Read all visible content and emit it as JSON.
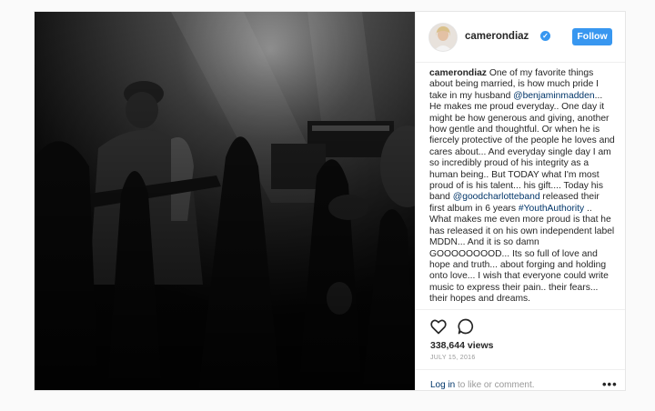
{
  "post": {
    "username": "camerondiaz",
    "follow_label": "Follow",
    "caption_parts": [
      {
        "type": "text",
        "text": " One of my favorite things about being married, is how much pride I take in my husband "
      },
      {
        "type": "link",
        "text": "@benjaminmadden"
      },
      {
        "type": "text",
        "text": "... He makes me proud everyday.. One day it might be how generous and giving, another how gentle and thoughtful. Or when he is fiercely protective of the people he loves and cares about... And everyday single day I am so incredibly proud of his integrity as a human being.. But TODAY what I'm most proud of is his talent... his gift.... Today his band "
      },
      {
        "type": "link",
        "text": "@goodcharlotteband"
      },
      {
        "type": "text",
        "text": " released their first album in 6 years "
      },
      {
        "type": "link",
        "text": "#YouthAuthority"
      },
      {
        "type": "text",
        "text": " .. What makes me even more proud is that he has released it on his own independent label MDDN... And it is so damn GOOOOOOOOD... Its so full of love and hope and truth... about forging and holding onto love... I wish that everyone could write music to express their pain.. their fears... their hopes and dreams."
      }
    ],
    "views": "338,644 views",
    "date": "JULY 15, 2016",
    "login_link": "Log in",
    "login_suffix": " to like or comment.",
    "more_label": "•••"
  },
  "icons": {
    "verified": "verified-badge-icon",
    "like": "heart-icon",
    "comment": "comment-bubble-icon",
    "more": "more-options-icon"
  },
  "colors": {
    "follow_button": "#3897f0",
    "link": "#003569",
    "meta_text": "#999999",
    "photo_bg": "#0a0a0a"
  }
}
